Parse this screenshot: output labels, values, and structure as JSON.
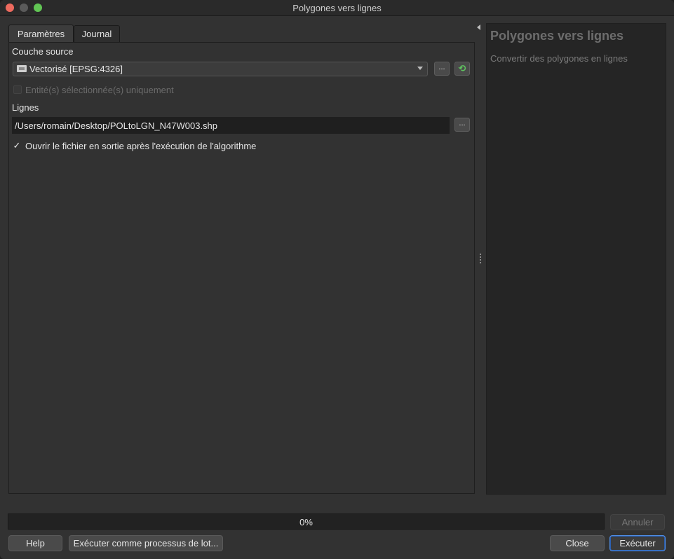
{
  "window": {
    "title": "Polygones vers lignes"
  },
  "tabs": [
    {
      "label": "Paramètres",
      "active": true
    },
    {
      "label": "Journal",
      "active": false
    }
  ],
  "params": {
    "source_label": "Couche source",
    "source_value": "Vectorisé [EPSG:4326]",
    "browse_label": "...",
    "selected_only_label": "Entité(s) sélectionnée(s) uniquement",
    "output_label": "Lignes",
    "output_path": "/Users/romain/Desktop/POLtoLGN_N47W003.shp",
    "open_output_label": "Ouvrir le fichier en sortie après l'exécution de l'algorithme",
    "check_mark": "✓"
  },
  "help": {
    "title": "Polygones vers lignes",
    "description": "Convertir des polygones en lignes"
  },
  "progress": {
    "text": "0%",
    "value": 0
  },
  "buttons": {
    "cancel": "Annuler",
    "help": "Help",
    "batch": "Exécuter comme processus de lot...",
    "close": "Close",
    "run": "Exécuter"
  },
  "icons": {
    "layer": "polygon-layer-icon",
    "refresh": "refresh-icon",
    "collapse": "collapse-arrow-icon"
  },
  "colors": {
    "refresh": "#5fc25f",
    "default_button_border": "#4f8de6"
  }
}
